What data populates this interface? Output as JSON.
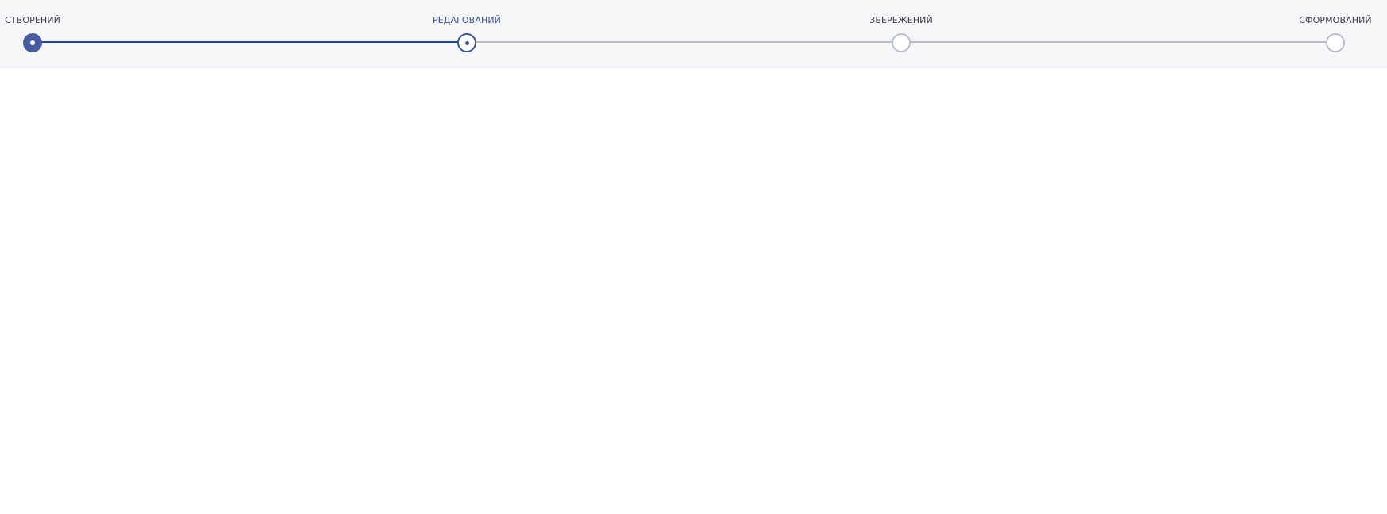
{
  "stepper": {
    "steps": [
      {
        "label": "СТВОРЕНИЙ",
        "state": "complete"
      },
      {
        "label": "РЕДАГОВАНИЙ",
        "state": "current"
      },
      {
        "label": "ЗБЕРЕЖЕНИЙ",
        "state": "pending"
      },
      {
        "label": "СФОРМОВАНИЙ",
        "state": "pending"
      }
    ],
    "colors": {
      "complete": "#475b9e",
      "current": "#3d5290",
      "done_line": "#2c3f80",
      "pending": "#babdc7",
      "background": "#f5f6f8"
    }
  }
}
